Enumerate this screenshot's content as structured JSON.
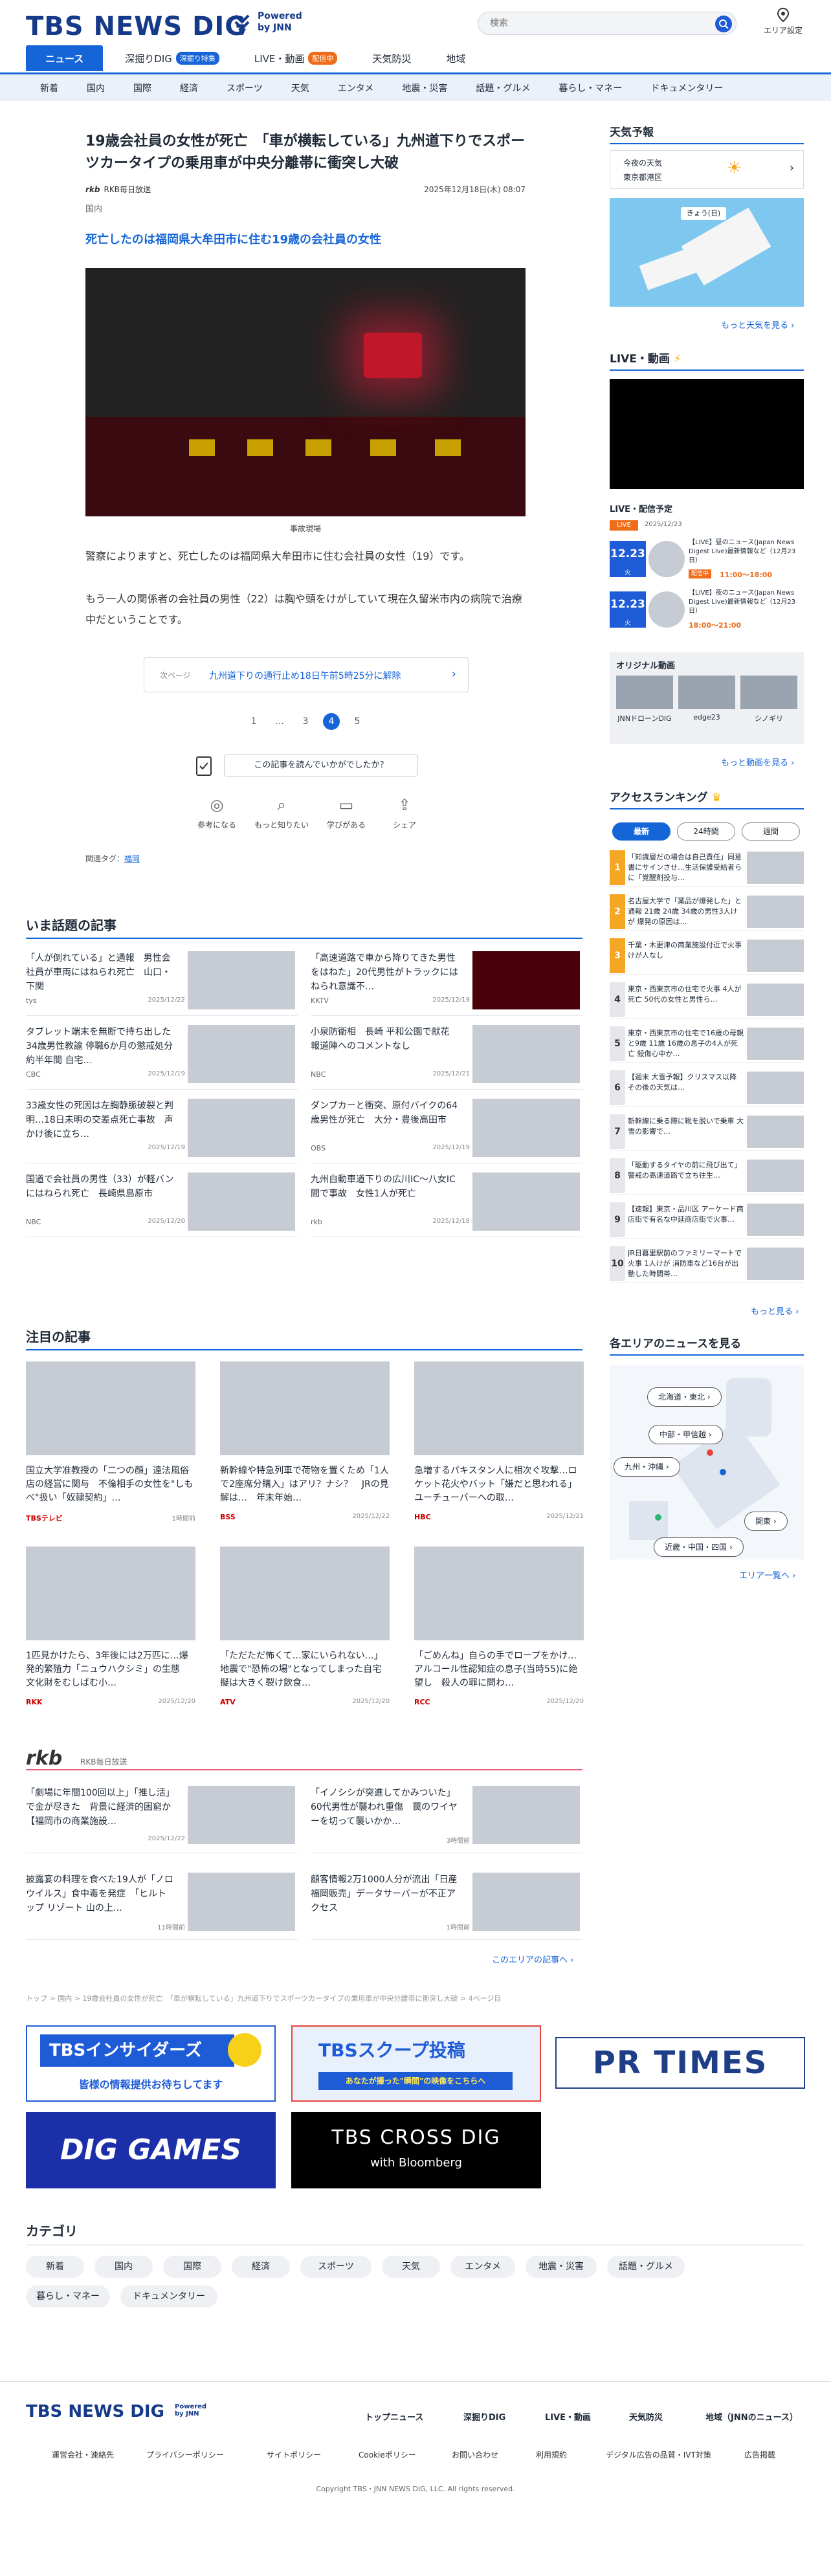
{
  "header": {
    "logo": "TBS NEWS DIG",
    "powered": "Powered",
    "by": "by JNN",
    "search_placeholder": "検索",
    "area_label": "エリア設定"
  },
  "nav": {
    "items": [
      {
        "label": "ニュース"
      },
      {
        "label": "深掘りDIG",
        "badge": "深掘り特集"
      },
      {
        "label": "LIVE・動画",
        "badge": "配信中"
      },
      {
        "label": "天気防災"
      },
      {
        "label": "地域"
      }
    ]
  },
  "subnav": [
    "新着",
    "国内",
    "国際",
    "経済",
    "スポーツ",
    "天気",
    "エンタメ",
    "地震・災害",
    "話題・グルメ",
    "暮らし・マネー",
    "ドキュメンタリー"
  ],
  "article": {
    "title": "19歳会社員の女性が死亡　「車が横転している」九州道下りでスポーツカータイプの乗用車が中央分離帯に衝突し大破",
    "source": "RKB毎日放送",
    "date": "2025年12月18日(木) 08:07",
    "category": "国内",
    "lead": "死亡したのは福岡県大牟田市に住む19歳の会社員の女性",
    "caption": "事故現場",
    "p1": "警察によりますと、死亡したのは福岡県大牟田市に住む会社員の女性（19）です。",
    "p2": "もう一人の関係者の会社員の男性（22）は胸や頭をけがしていて現在久留米市内の病院で治療中だということです。",
    "next_label": "次ページ",
    "next_text": "九州道下りの通行止め18日午前5時25分に解除",
    "pager": [
      "1",
      "…",
      "3",
      "4",
      "5"
    ],
    "feedback_q": "この記事を読んでいかがでしたか？",
    "feedback_btns": [
      "参考になる",
      "もっと知りたい",
      "学びがある",
      "シェア"
    ],
    "tags_label": "関連タグ：",
    "tag": "福岡"
  },
  "popular": {
    "heading": "いま話題の記事",
    "items": [
      {
        "title": "「人が倒れている」と通報　男性会社員が車両にはねられ死亡　山口・下関",
        "src": "tys",
        "date": "2025/12/22"
      },
      {
        "title": "「高速道路で車から降りてきた男性をはねた」20代男性がトラックにはねられ意識不…",
        "src": "KKTV",
        "date": "2025/12/19"
      },
      {
        "title": "タブレット端末を無断で持ち出した34歳男性教諭 停職6か月の懲戒処分 約半年間 自宅…",
        "src": "CBC",
        "date": "2025/12/19"
      },
      {
        "title": "小泉防衛相　長崎 平和公園で献花 報道陣へのコメントなし",
        "src": "NBC",
        "date": "2025/12/21"
      },
      {
        "title": "33歳女性の死因は左胸静脈破裂と判明…18日未明の交差点死亡事故　声かけ後に立ち…",
        "src": "",
        "date": "2025/12/19"
      },
      {
        "title": "ダンプカーと衝突、原付バイクの64歳男性が死亡　大分・豊後高田市",
        "src": "OBS",
        "date": "2025/12/19"
      },
      {
        "title": "国道で会社員の男性（33）が軽バンにはねられ死亡　長崎県島原市",
        "src": "NBC",
        "date": "2025/12/20"
      },
      {
        "title": "九州自動車道下りの広川IC〜八女IC間で事故　女性1人が死亡",
        "src": "rkb",
        "date": "2025/12/18"
      }
    ]
  },
  "featured": {
    "heading": "注目の記事",
    "items": [
      {
        "title": "国立大学准教授の「二つの顔」遠法風俗店の経営に関与　不倫相手の女性を\"しもべ\"扱い「奴隷契約」…",
        "src": "TBSテレビ",
        "date": "1時間前"
      },
      {
        "title": "新幹線や特急列車で荷物を置くため「1人で2座席分購入」はアリ？ナシ？　JRの見解は…　年末年始…",
        "src": "BSS",
        "date": "2025/12/22"
      },
      {
        "title": "急増するパキスタン人に相次ぐ攻撃…ロケット花火やバット「嫌だと思われる」ユーチューバーへの取…",
        "src": "HBC",
        "date": "2025/12/21"
      },
      {
        "title": "1匹見かけたら、3年後には2万匹に…爆発的繁殖力「ニュウハクシミ」の生態　文化財をむしばむ小…",
        "src": "RKK",
        "date": "2025/12/20"
      },
      {
        "title": "「ただただ怖くて…家にいられない…」地震で\"恐怖の場\"となってしまった自宅　擬は大きく裂け飲食…",
        "src": "ATV",
        "date": "2025/12/20"
      },
      {
        "title": "「ごめんね」自らの手でロープをかけ…アルコール性認知症の息子(当時55)に絶望し　殺人の罪に問わ…",
        "src": "RCC",
        "date": "2025/12/20"
      }
    ]
  },
  "local": {
    "logo": "rkb",
    "label": "RKB毎日放送",
    "more": "このエリアの記事へ",
    "items": [
      {
        "title": "「劇場に年間100回以上」「推し活」で金が尽きた　背景に経済的困窮か　【福岡市の商業施設…",
        "date": "2025/12/22"
      },
      {
        "title": "「イノシシが突進してかみついた」60代男性が襲われ重傷　罠のワイヤーを切って襲いかか…",
        "date": "3時間前"
      },
      {
        "title": "披露宴の料理を食べた19人が「ノロウイルス」食中毒を発症　「ヒルトップ リゾート 山の上…",
        "date": "11時間前"
      },
      {
        "title": "顧客情報2万1000人分が流出「日産福岡販売」データサーバーが不正アクセス",
        "date": "1時間前"
      }
    ]
  },
  "breadcrumb": "トップ > 国内 > 19歳会社員の女性が死亡　「車が横転している」九州道下りでスポーツカータイプの乗用車が中央分離帯に衝突し大破 > 4ページ目",
  "banners": {
    "insiders": "TBSインサイダーズ",
    "insiders_sub": "皆様の情報提供お待ちしてます",
    "scoop": "TBSスクープ投稿",
    "scoop_sub": "あなたが撮った\"瞬間\"の映像をこちらへ",
    "prtimes": "PR TIMES",
    "games": "DIG GAMES",
    "crossdig": "TBS CROSS DIG",
    "crossdig_sub": "with Bloomberg"
  },
  "categories": {
    "heading": "カテゴリ",
    "items": [
      "新着",
      "国内",
      "国際",
      "経済",
      "スポーツ",
      "天気",
      "エンタメ",
      "地震・災害",
      "話題・グルメ",
      "暮らし・マネー",
      "ドキュメンタリー"
    ]
  },
  "sidebar": {
    "weather": {
      "heading": "天気予報",
      "today": "今夜の天気",
      "city": "東京都港区",
      "more": "もっと天気を見る",
      "map_label": "きょう(日)"
    },
    "live": {
      "heading": "LIVE・動画",
      "schedule_heading": "LIVE・配信予定",
      "now_badge": "LIVE",
      "now_date": "2025/12/23",
      "items": [
        {
          "date": "12.23",
          "dow": "火",
          "title": "【LIVE】昼のニュース(Japan News Digest Live)最新情報など（12月23日）",
          "time": "11:00～18:00",
          "tag": "配信中"
        },
        {
          "date": "12.23",
          "dow": "火",
          "title": "【LIVE】夜のニュース(Japan News Digest Live)最新情報など（12月23日）",
          "time": "18:00～21:00"
        }
      ],
      "original_heading": "オリジナル動画",
      "originals": [
        "JNNドローンDIG",
        "edge23",
        "シノギリ"
      ],
      "more": "もっと動画を見る"
    },
    "ranking": {
      "heading": "アクセスランキング",
      "tabs": [
        "最新",
        "24時間",
        "週間"
      ],
      "more": "もっと見る",
      "items": [
        "「知識層だの場合は自己責任」同意書にサインさせ…生活保護受給者らに「覚醒剤投与…",
        "名古屋大学で「薬品が爆発した」と通報 21歳 24歳 34歳の男性3人けが 爆発の原因は…",
        "千葉・木更津の商業施設付近で火事 けが人なし",
        "東京・西東京市の住宅で火事 4人が死亡 50代の女性と男性ら…",
        "東京・西東京市の住宅で16歳の母親と9歳 11歳 16歳の息子の4人が死亡 殺傷心中か…",
        "【週末 大雪予報】クリスマス以降 その後の天気は…",
        "新幹線に乗る際に靴を脱いで乗車 大雪の影響で…",
        "「駆動するタイヤの前に飛び出て」警戒の高速道路で立ち往生…",
        "【速報】東京・品川区 アーケード商店街で有名な中延商店街で火事…",
        "JR日暮里駅前のファミリーマートで火事 1人けが 消防車など16台が出動した時間帯…"
      ]
    },
    "regions": {
      "heading": "各エリアのニュースを見る",
      "items": [
        "北海道・東北",
        "中部・甲信越",
        "九州・沖縄",
        "関東",
        "近畿・中国・四国"
      ],
      "more": "エリア一覧へ"
    }
  },
  "footer": {
    "logo": "TBS NEWS DIG",
    "powered": "Powered by JNN",
    "nav": [
      "トップニュース",
      "深掘りDIG",
      "LIVE・動画",
      "天気防災",
      "地域（JNNのニュース）"
    ],
    "links": [
      "運営会社・連絡先",
      "プライバシーポリシー",
      "サイトポリシー",
      "Cookieポリシー",
      "お問い合わせ",
      "利用規約",
      "デジタル広告の品質・IVT対策",
      "広告掲載"
    ],
    "copyright": "Copyright TBS・JNN NEWS DIG, LLC. All rights reserved."
  },
  "colors": {
    "brand": "#163a8a",
    "accent": "#1565d8",
    "live": "#ef6c1a"
  }
}
